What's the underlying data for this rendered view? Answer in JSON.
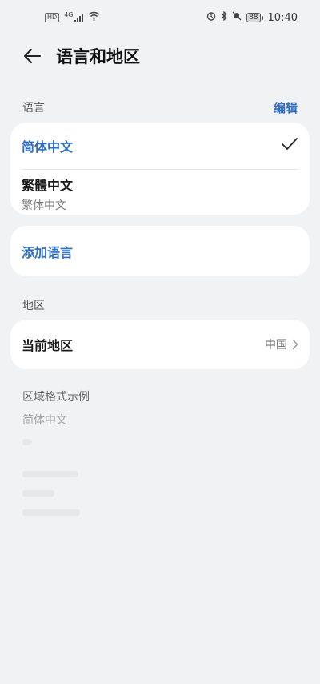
{
  "status_bar": {
    "time": "10:40",
    "hd_label": "HD",
    "network": "4G",
    "battery": "88"
  },
  "header": {
    "title": "语言和地区"
  },
  "language_section": {
    "label": "语言",
    "edit_label": "编辑",
    "languages": [
      {
        "name": "简体中文",
        "selected": true
      },
      {
        "name": "繁體中文",
        "subtitle": "繁体中文",
        "selected": false
      }
    ],
    "add_label": "添加语言"
  },
  "region_section": {
    "label": "地区",
    "current_region_label": "当前地区",
    "current_region_value": "中国"
  },
  "format_section": {
    "title": "区域格式示例",
    "sample": "简体中文"
  },
  "colors": {
    "accent": "#2e6ec6",
    "background": "#f1f2f4",
    "card": "#ffffff"
  }
}
